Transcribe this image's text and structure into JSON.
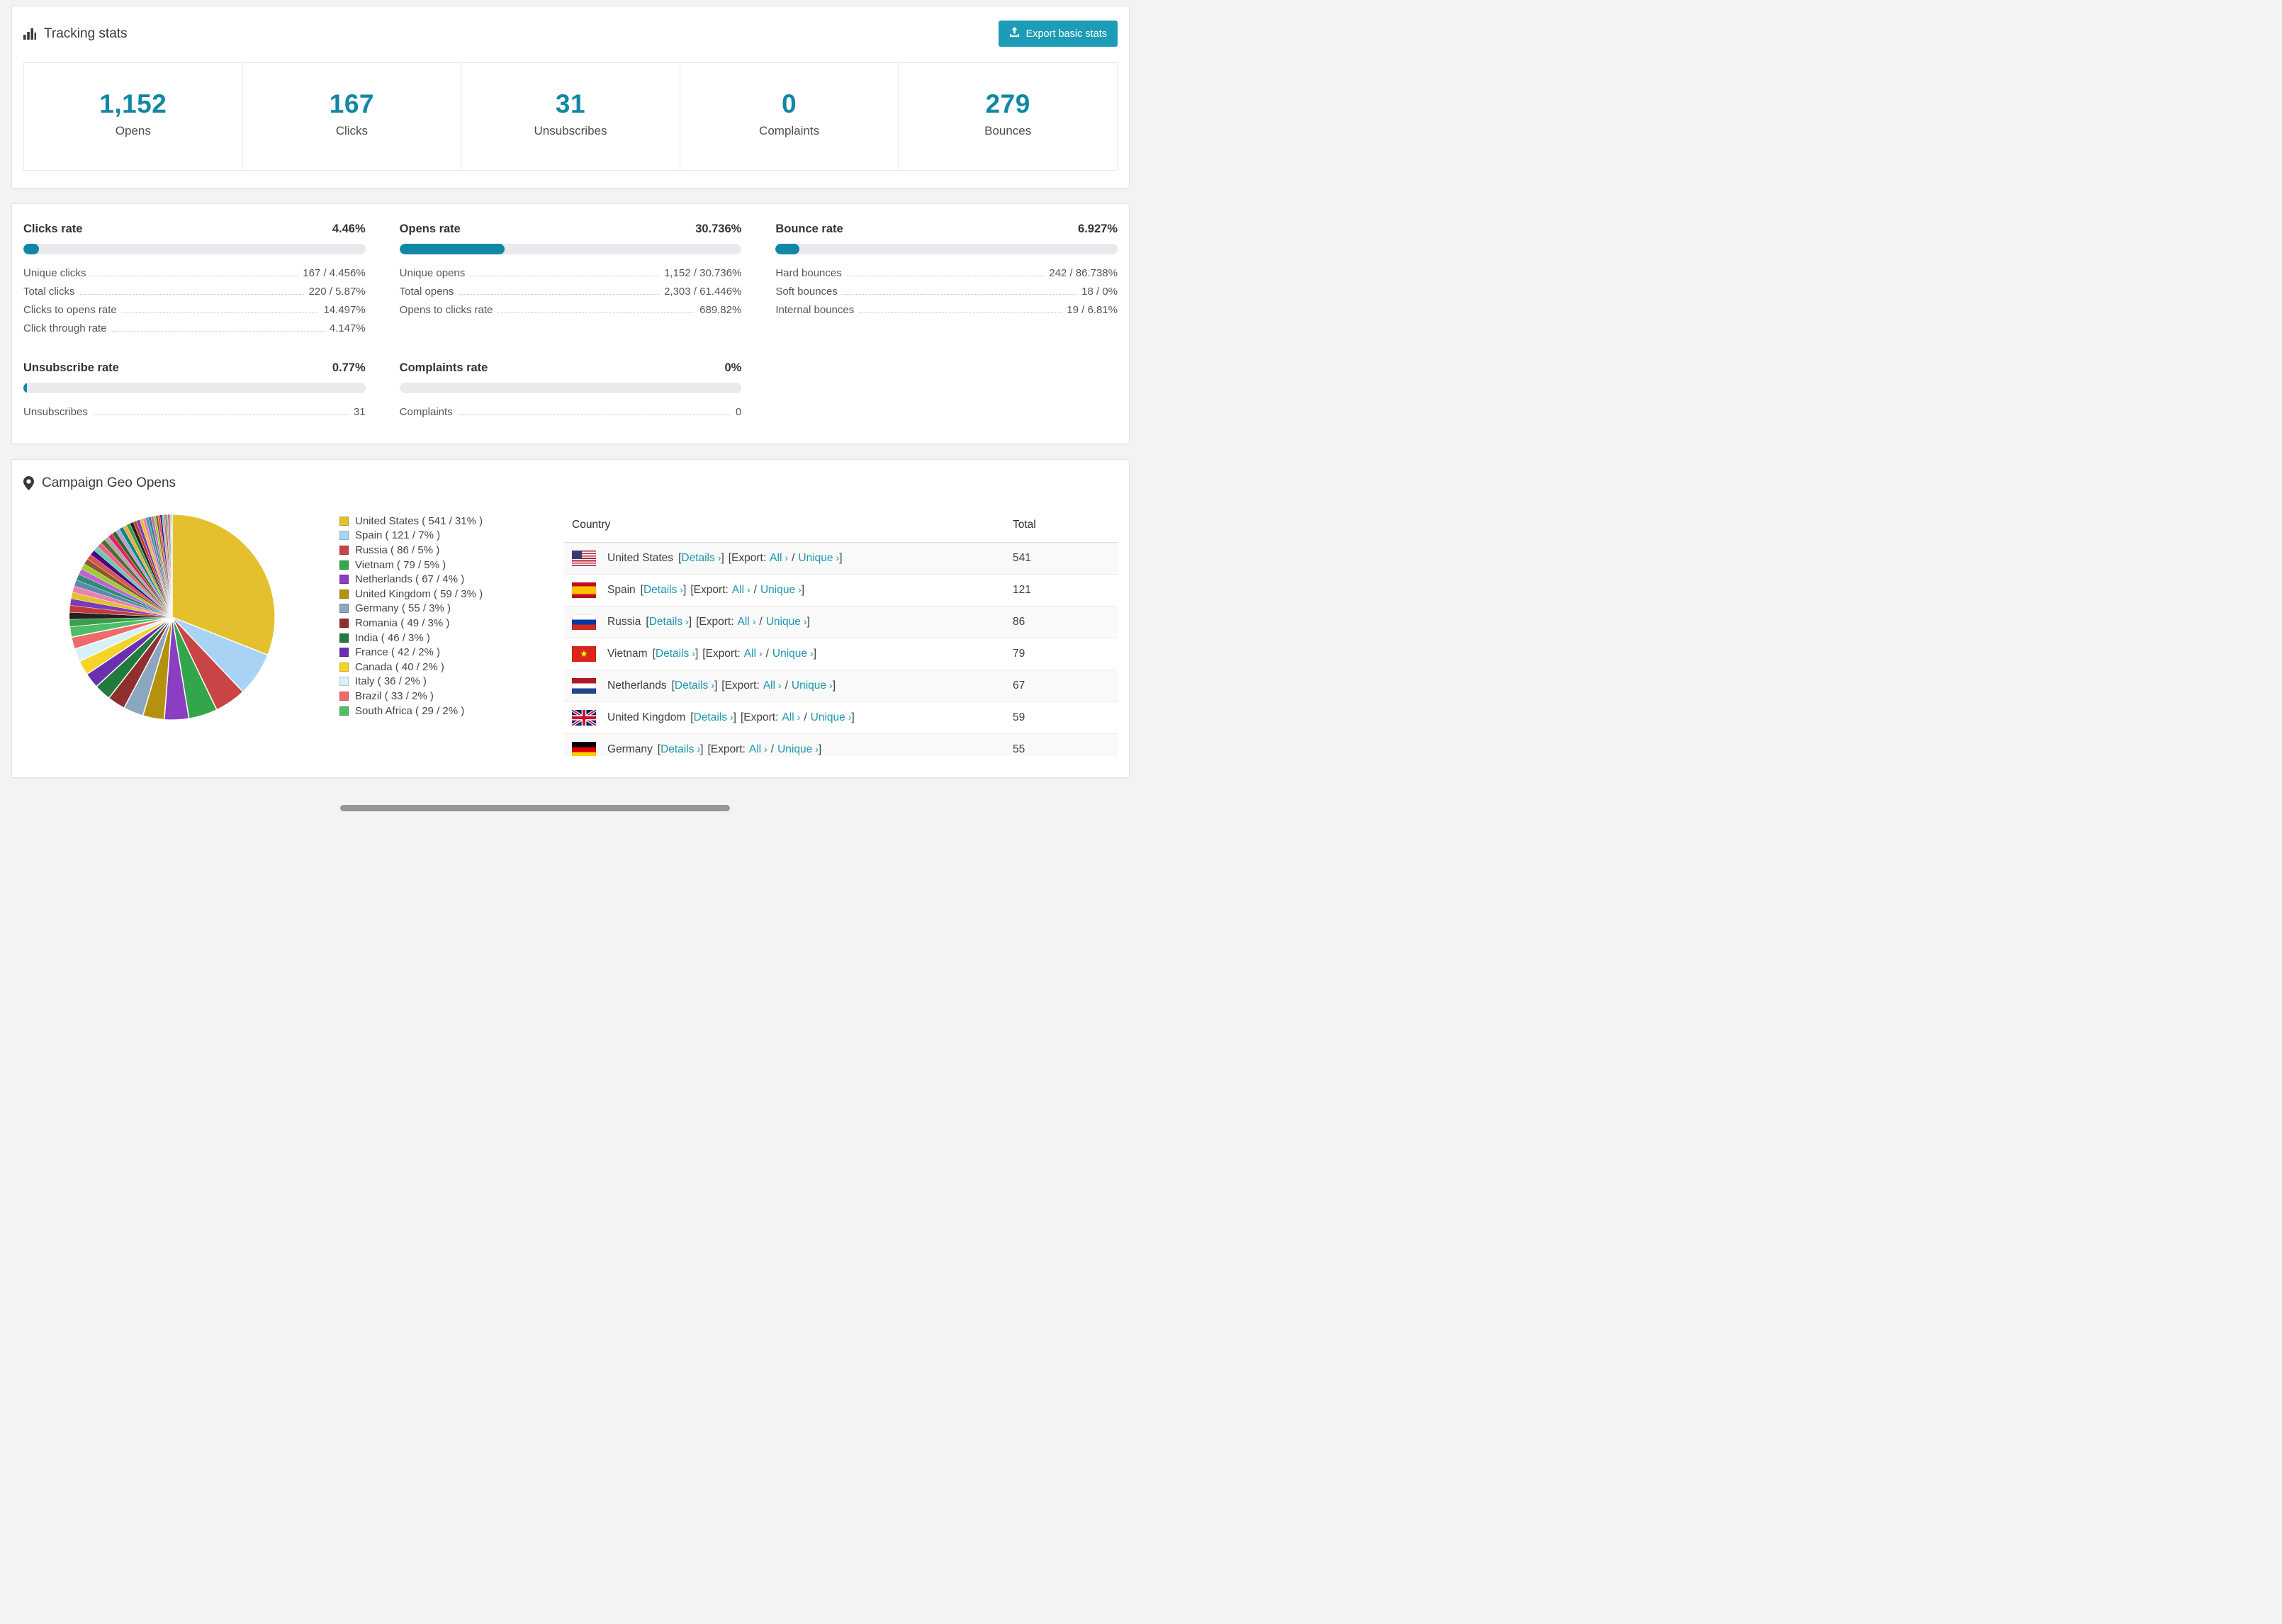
{
  "colors": {
    "accent": "#1286a6",
    "button": "#1d9cb7",
    "link": "#1b97ae"
  },
  "tracking": {
    "title": "Tracking stats",
    "export_button": "Export basic stats",
    "stats": [
      {
        "value": "1,152",
        "label": "Opens"
      },
      {
        "value": "167",
        "label": "Clicks"
      },
      {
        "value": "31",
        "label": "Unsubscribes"
      },
      {
        "value": "0",
        "label": "Complaints"
      },
      {
        "value": "279",
        "label": "Bounces"
      }
    ]
  },
  "rates": {
    "blocks": [
      {
        "title": "Clicks rate",
        "percent_label": "4.46%",
        "percent": 4.46,
        "rows": [
          {
            "label": "Unique clicks",
            "value": "167 / 4.456%"
          },
          {
            "label": "Total clicks",
            "value": "220 / 5.87%"
          },
          {
            "label": "Clicks to opens rate",
            "value": "14.497%"
          },
          {
            "label": "Click through rate",
            "value": "4.147%"
          }
        ]
      },
      {
        "title": "Opens rate",
        "percent_label": "30.736%",
        "percent": 30.736,
        "rows": [
          {
            "label": "Unique opens",
            "value": "1,152 / 30.736%"
          },
          {
            "label": "Total opens",
            "value": "2,303 / 61.446%"
          },
          {
            "label": "Opens to clicks rate",
            "value": "689.82%"
          }
        ]
      },
      {
        "title": "Bounce rate",
        "percent_label": "6.927%",
        "percent": 6.927,
        "rows": [
          {
            "label": "Hard bounces",
            "value": "242 / 86.738%"
          },
          {
            "label": "Soft bounces",
            "value": "18 / 0%"
          },
          {
            "label": "Internal bounces",
            "value": "19 / 6.81%"
          }
        ]
      },
      {
        "title": "Unsubscribe rate",
        "percent_label": "0.77%",
        "percent": 0.77,
        "rows": [
          {
            "label": "Unsubscribes",
            "value": "31"
          }
        ]
      },
      {
        "title": "Complaints rate",
        "percent_label": "0%",
        "percent": 0,
        "rows": [
          {
            "label": "Complaints",
            "value": "0"
          }
        ]
      }
    ]
  },
  "geo": {
    "title": "Campaign Geo Opens"
  },
  "chart_data": {
    "type": "pie",
    "title": "Campaign Geo Opens",
    "legend_position": "right",
    "series": [
      {
        "label": "United States",
        "value": 541,
        "percent": 31,
        "color": "#e4c02e"
      },
      {
        "label": "Spain",
        "value": 121,
        "percent": 7,
        "color": "#a9d3f5"
      },
      {
        "label": "Russia",
        "value": 86,
        "percent": 5,
        "color": "#c94444"
      },
      {
        "label": "Vietnam",
        "value": 79,
        "percent": 5,
        "color": "#33a64c"
      },
      {
        "label": "Netherlands",
        "value": 67,
        "percent": 4,
        "color": "#8a3ec2"
      },
      {
        "label": "United Kingdom",
        "value": 59,
        "percent": 3,
        "color": "#b5920e"
      },
      {
        "label": "Germany",
        "value": 55,
        "percent": 3,
        "color": "#8ba6c1"
      },
      {
        "label": "Romania",
        "value": 49,
        "percent": 3,
        "color": "#8f2f2f"
      },
      {
        "label": "India",
        "value": 46,
        "percent": 3,
        "color": "#227a3c"
      },
      {
        "label": "France",
        "value": 42,
        "percent": 2,
        "color": "#6a2fae"
      },
      {
        "label": "Canada",
        "value": 40,
        "percent": 2,
        "color": "#f5d327"
      },
      {
        "label": "Italy",
        "value": 36,
        "percent": 2,
        "color": "#d8f0f8"
      },
      {
        "label": "Brazil",
        "value": 33,
        "percent": 2,
        "color": "#ef6a6a"
      },
      {
        "label": "South Africa",
        "value": 29,
        "percent": 2,
        "color": "#4dbd66"
      }
    ],
    "others": {
      "value": 462,
      "slice_count": 46,
      "palette": [
        "#3a9e4d",
        "#222222",
        "#c23b3b",
        "#7a3bb5",
        "#e0c22c",
        "#ea7fb1",
        "#5d8aa8",
        "#2e8b74",
        "#c061d6",
        "#9acd32",
        "#8b5a2b",
        "#d9534f",
        "#4b0082",
        "#66cdaa",
        "#f06292",
        "#556b2f",
        "#a9a9a9",
        "#e91e63",
        "#33691e",
        "#b39ddb",
        "#00897b",
        "#f4a742"
      ]
    }
  },
  "geo_table": {
    "headers": {
      "country": "Country",
      "total": "Total"
    },
    "link_labels": {
      "details": "Details",
      "export": "Export:",
      "all": "All",
      "unique": "Unique",
      "chevron": "›"
    },
    "punct": {
      "open": "[",
      "close": "]",
      "slash": "/"
    },
    "rows": [
      {
        "country": "United States",
        "total": "541"
      },
      {
        "country": "Spain",
        "total": "121"
      },
      {
        "country": "Russia",
        "total": "86"
      },
      {
        "country": "Vietnam",
        "total": "79"
      },
      {
        "country": "Netherlands",
        "total": "67"
      },
      {
        "country": "United Kingdom",
        "total": "59"
      },
      {
        "country": "Germany",
        "total": "55"
      }
    ]
  }
}
